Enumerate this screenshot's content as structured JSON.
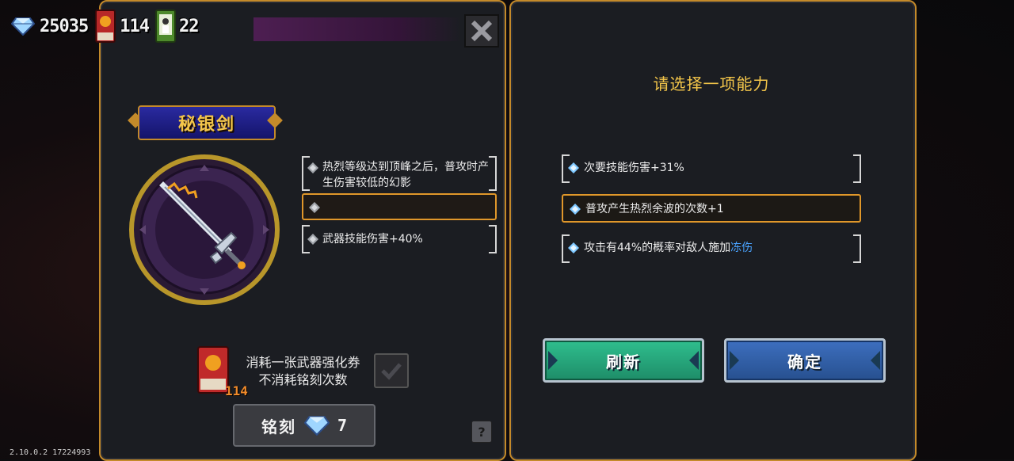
{
  "currency": {
    "gems": "25035",
    "tickets": "114",
    "cards": "22"
  },
  "weapon": {
    "name": "秘银剑"
  },
  "affixes": [
    {
      "text": "热烈等级达到顶峰之后，普攻时产生伤害较低的幻影"
    },
    {
      "text": ""
    },
    {
      "text": "武器技能伤害+40%"
    }
  ],
  "choice": {
    "prompt": "请选择一项能力",
    "options": [
      {
        "text": "次要技能伤害+31%"
      },
      {
        "text": "普攻产生热烈余波的次数+1"
      },
      {
        "text_prefix": "攻击有44%的概率对敌人施加",
        "text_highlight": "冻伤"
      }
    ],
    "refresh_label": "刷新",
    "confirm_label": "确定"
  },
  "engrave": {
    "ticket_count": "114",
    "consume_text_line1": "消耗一张武器强化券",
    "consume_text_line2": "不消耗铭刻次数",
    "button_label": "铭刻",
    "cost": "7"
  },
  "help_label": "?",
  "version": "2.10.0.2 17224993",
  "colors": {
    "gold_border": "#c48a2a",
    "prompt_text": "#f4c64a",
    "refresh_green": "#2fbf8e",
    "confirm_blue": "#3d6fbf",
    "highlight_blue": "#4aa3ff",
    "selected_orange": "#e0972a"
  },
  "icons": {
    "gem": "diamond-gem-icon",
    "ticket": "weapon-upgrade-ticket-icon",
    "card": "character-card-icon",
    "close": "close-x-icon",
    "check": "checkmark-icon",
    "help": "question-mark-icon"
  }
}
